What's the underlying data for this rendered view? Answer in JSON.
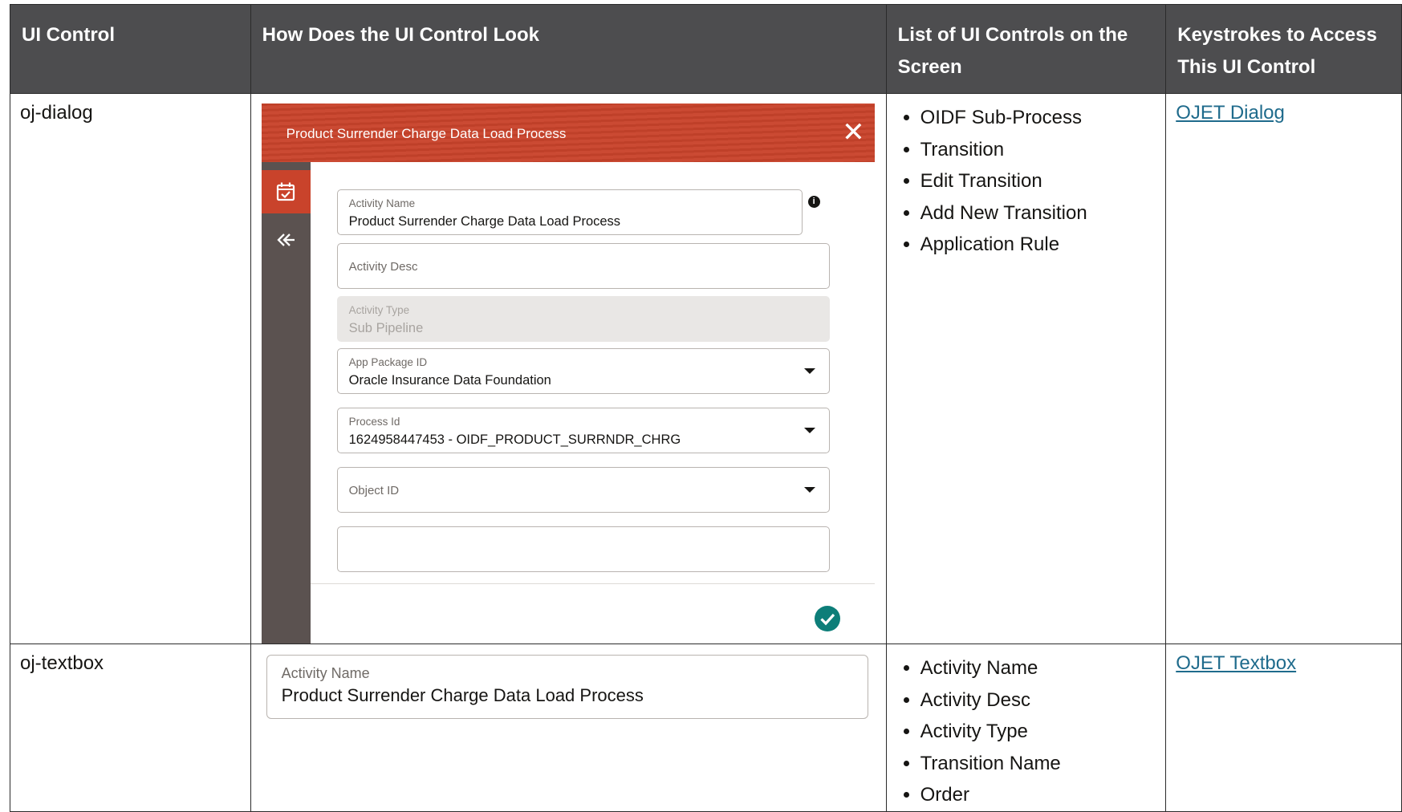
{
  "table": {
    "headers": [
      "UI Control",
      "How Does the UI Control Look",
      "List of UI Controls on the Screen",
      "Keystrokes to Access This UI Control"
    ],
    "rows": [
      {
        "control": "oj-dialog",
        "controls_list": [
          "OIDF Sub-Process",
          "Transition",
          "Edit Transition",
          "Add New Transition",
          "Application Rule"
        ],
        "link": "OJET Dialog"
      },
      {
        "control": "oj-textbox",
        "controls_list": [
          "Activity Name",
          "Activity Desc",
          "Activity Type",
          "Transition Name",
          "Order"
        ],
        "link": "OJET Textbox"
      }
    ]
  },
  "dialog": {
    "title": "Product Surrender Charge Data Load Process",
    "close_icon": "close-icon",
    "info_glyph": "i",
    "fields": {
      "activity_name": {
        "label": "Activity Name",
        "value": "Product Surrender Charge Data Load Process"
      },
      "activity_desc": {
        "label": "Activity Desc"
      },
      "activity_type": {
        "label": "Activity Type",
        "value": "Sub Pipeline"
      },
      "app_package_id": {
        "label": "App Package ID",
        "value": "Oracle Insurance Data Foundation"
      },
      "process_id": {
        "label": "Process Id",
        "value": "1624958447453 - OIDF_PRODUCT_SURRNDR_CHRG"
      },
      "object_id": {
        "label": "Object ID"
      }
    },
    "colors": {
      "header": "#c9432b",
      "rail": "#5b5250",
      "ok": "#0d7e79"
    }
  },
  "textbox": {
    "label": "Activity Name",
    "value": "Product Surrender Charge Data Load Process"
  }
}
